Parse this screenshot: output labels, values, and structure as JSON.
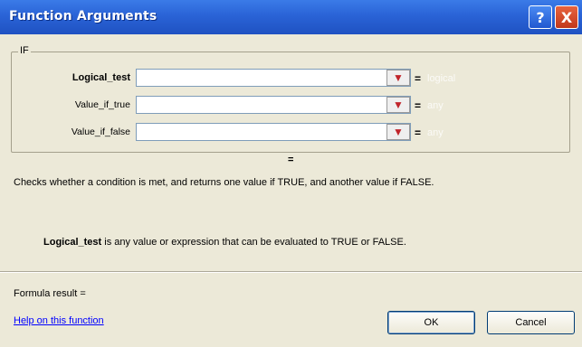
{
  "window": {
    "title": "Function Arguments",
    "help_button": "?",
    "close_button": "X"
  },
  "group": {
    "label": "IF",
    "args": [
      {
        "label": "Logical_test",
        "value": "",
        "hint": "logical",
        "bold": true
      },
      {
        "label": "Value_if_true",
        "value": "",
        "hint": "any",
        "bold": false
      },
      {
        "label": "Value_if_false",
        "value": "",
        "hint": "any",
        "bold": false
      }
    ],
    "equals": "="
  },
  "formula_equals": "=",
  "description": "Checks whether a condition is met, and returns one value if TRUE, and another value if FALSE.",
  "arg_description": {
    "name": "Logical_test",
    "text": " is any value or expression that can be evaluated to TRUE or FALSE."
  },
  "formula_result": "Formula result =",
  "help_link": "Help on this function",
  "buttons": {
    "ok": "OK",
    "cancel": "Cancel"
  },
  "icons": {
    "collapse": "range-collapse-icon"
  }
}
